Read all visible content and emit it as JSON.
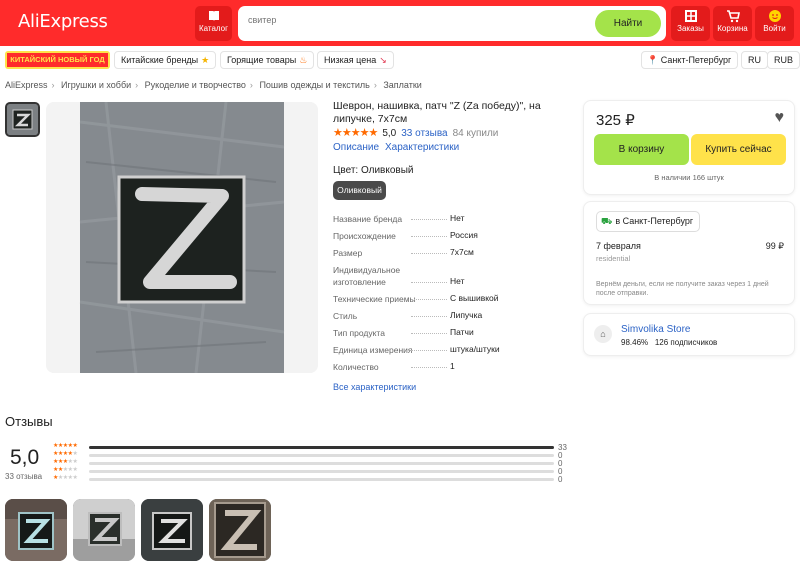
{
  "header": {
    "logo": "AliExpress",
    "catalog_label": "Каталог",
    "search_placeholder": "свитер",
    "search_button": "Найти",
    "orders_label": "Заказы",
    "cart_label": "Корзина",
    "login_label": "Войти",
    "accent_color": "#ff2b2b"
  },
  "topbar": {
    "promo_label": "КИТАЙСКИЙ НОВЫЙ ГОД",
    "chips": [
      "Китайские бренды",
      "Горящие товары",
      "Низкая цена"
    ],
    "location": "Санкт-Петербург",
    "language": "RU",
    "currency": "RUB"
  },
  "breadcrumbs": [
    "AliExpress",
    "Игрушки и хобби",
    "Рукоделие и творчество",
    "Пошив одежды и текстиль",
    "Заплатки"
  ],
  "product": {
    "title": "Шеврон, нашивка, патч \"Z (Za победу)\", на липучке, 7x7см",
    "stars": "★★★★★",
    "rating": "5,0",
    "reviews_link": "33 отзыва",
    "bought": "84 купили",
    "tabs": [
      "Описание",
      "Характеристики"
    ],
    "color_label": "Цвет: Оливковый",
    "color_option": "Оливковый",
    "specs": [
      {
        "key": "Название бренда",
        "value": "Нет"
      },
      {
        "key": "Происхождение",
        "value": "Россия"
      },
      {
        "key": "Размер",
        "value": "7x7см"
      },
      {
        "key": "Индивидуальное изготовление",
        "value": "Нет"
      },
      {
        "key": "Технические приемы",
        "value": "С вышивкой"
      },
      {
        "key": "Стиль",
        "value": "Липучка"
      },
      {
        "key": "Тип продукта",
        "value": "Патчи"
      },
      {
        "key": "Единица измерения",
        "value": "штука/штуки"
      },
      {
        "key": "Количество",
        "value": "1"
      }
    ],
    "all_specs_link": "Все характеристики"
  },
  "buy_box": {
    "price": "325 ₽",
    "cart_button": "В корзину",
    "buy_button": "Купить сейчас",
    "stock": "В наличии 166 штук"
  },
  "shipping": {
    "destination": "в Санкт-Петербург",
    "date": "7 февраля",
    "provider": "residential",
    "price": "99 ₽",
    "refund_note": "Вернём деньги, если не получите заказ через 1 дней после отправки."
  },
  "store": {
    "name": "Simvolika Store",
    "positive": "98.46%",
    "subscribers": "126 подписчиков"
  },
  "reviews": {
    "title": "Отзывы",
    "rating": "5,0",
    "count_label": "33 отзыва",
    "distribution": [
      {
        "stars": 5,
        "count": "33",
        "fraction": 1.0
      },
      {
        "stars": 4,
        "count": "0",
        "fraction": 0
      },
      {
        "stars": 3,
        "count": "0",
        "fraction": 0
      },
      {
        "stars": 2,
        "count": "0",
        "fraction": 0
      },
      {
        "stars": 1,
        "count": "0",
        "fraction": 0
      }
    ]
  }
}
